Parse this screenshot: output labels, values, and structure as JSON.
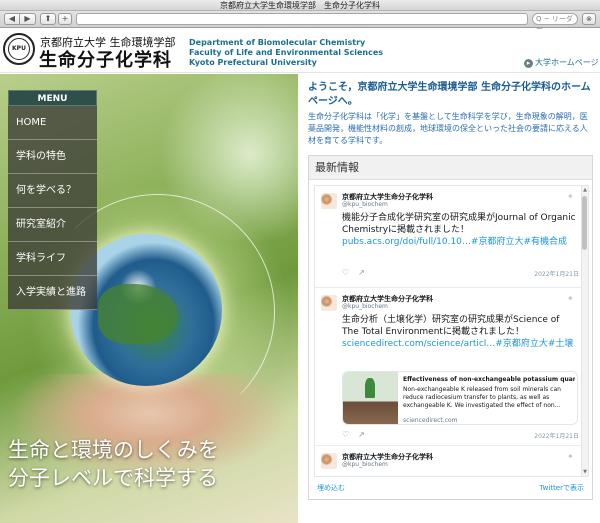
{
  "browser": {
    "title": "京都府立大学生命環境学部　生命分子化学科",
    "back": "◀",
    "forward": "▶",
    "share": "⬆",
    "new_tab": "+",
    "search_placeholder": "Q ~ リーダー",
    "stop": "⊗"
  },
  "header": {
    "logo_text": "KPU",
    "univ_line": "京都府立大学 生命環境学部",
    "dept_line": "生命分子化学科",
    "en_1": "Department of Biomolecular Chemistry",
    "en_2": "Faculty of Life and Environmental Sciences",
    "en_3": "Kyoto Prefectural University",
    "univ_home": "大学ホームページ"
  },
  "menu": {
    "heading": "MENU",
    "items": [
      "HOME",
      "学科の特色",
      "何を学べる？",
      "研究室紹介",
      "学科ライフ",
      "入学実績と進路"
    ]
  },
  "hero": {
    "tagline_1": "生命と環境のしくみを",
    "tagline_2": "分子レベルで科学する"
  },
  "welcome": {
    "title": "ようこそ，京都府立大学生命環境学部 生命分子化学科のホームページへ。",
    "body": "生命分子化学科は「化学」を基盤として生命科学を学び，生命現象の解明，医薬品開発，機能性材料の創成，地球環境の保全といった社会の要請に応える人材を育てる学科です。"
  },
  "news": {
    "heading": "最新情報",
    "tweets": [
      {
        "name": "京都府立大学生命分子化学科",
        "handle": "@kpu_biochem",
        "text": "機能分子合成化学研究室の研究成果がJournal of Organic Chemistryに掲載されました！",
        "link": "pubs.acs.org/doi/full/10.10…#京都府立大#有機合成",
        "date": "2022年1月21日"
      },
      {
        "name": "京都府立大学生命分子化学科",
        "handle": "@kpu_biochem",
        "text": "生命分析（土壌化学）研究室の研究成果がScience of The Total Environmentに掲載されました！",
        "link": "sciencedirect.com/science/articl…#京都府立大#土壌",
        "card_title": "Effectiveness of non-exchangeable potassium quantified…",
        "card_desc": "Non-exchangeable K released from soil minerals can reduce radiocesium transfer to plants, as well as exchangeable K. We investigated the effect of non…",
        "card_domain": "sciencedirect.com",
        "date": "2022年1月21日"
      },
      {
        "name": "京都府立大学生命分子化学科",
        "handle": "@kpu_biochem"
      }
    ],
    "embed": "埋め込む",
    "view_on_twitter": "Twitterで表示"
  }
}
